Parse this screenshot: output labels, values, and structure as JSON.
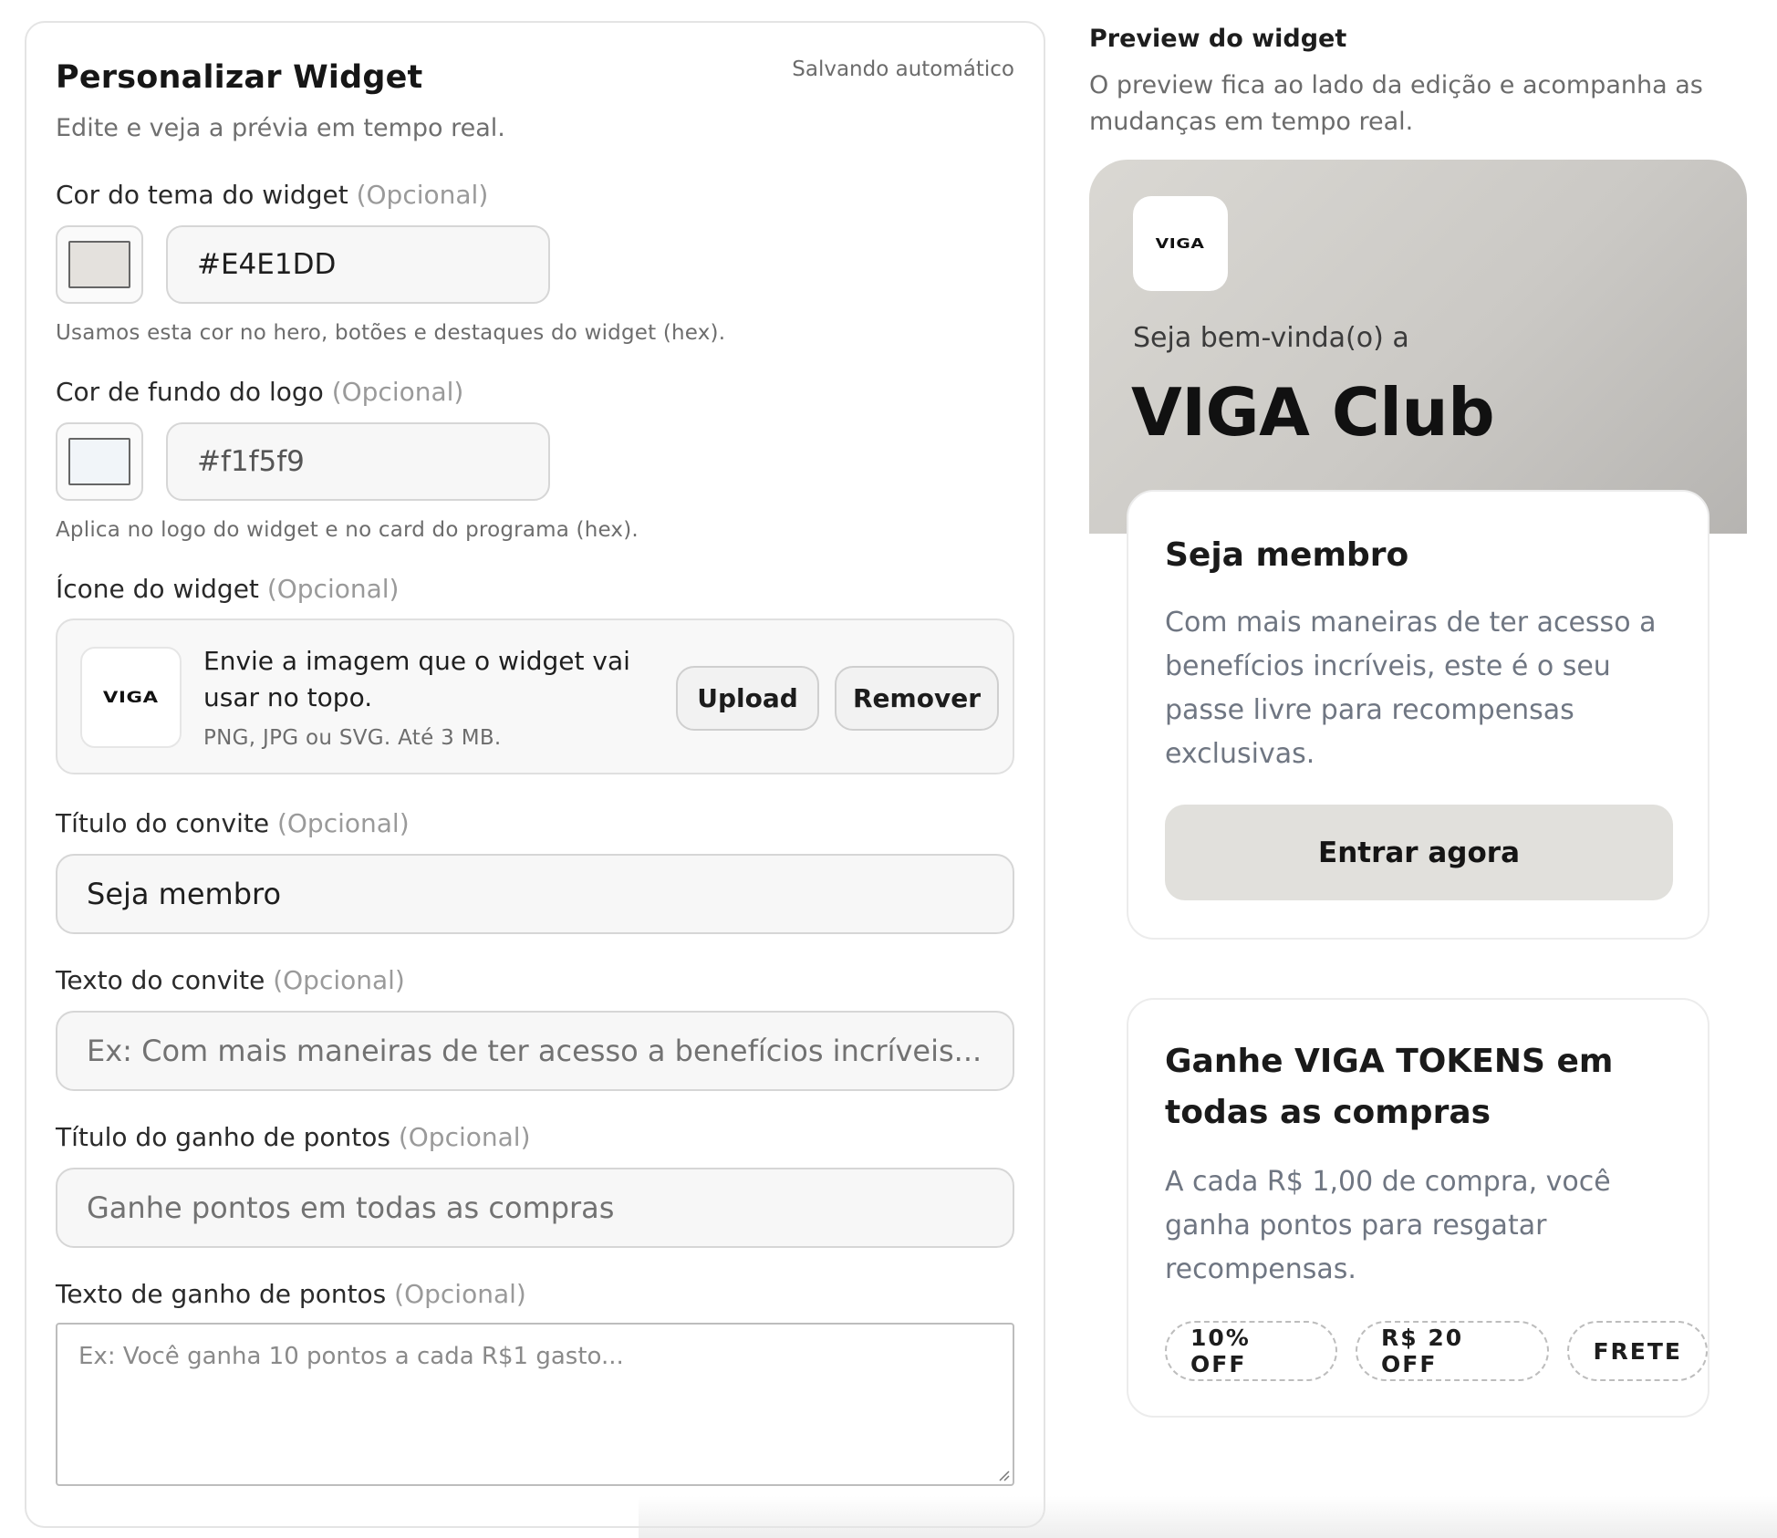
{
  "editor": {
    "title": "Personalizar Widget",
    "autosave": "Salvando automático",
    "subtitle": "Edite e veja a prévia em tempo real.",
    "optional_tag": "(Opcional)",
    "theme_color": {
      "label": "Cor do tema do widget",
      "value": "#E4E1DD",
      "swatch": "#E4E1DD",
      "hint": "Usamos esta cor no hero, botões e destaques do widget (hex)."
    },
    "logo_bg_color": {
      "label": "Cor de fundo do logo",
      "value": "#f1f5f9",
      "swatch": "#f1f5f9",
      "hint": "Aplica no logo do widget e no card do programa (hex)."
    },
    "widget_icon": {
      "label": "Ícone do widget",
      "logo_text": "VIGA",
      "description": "Envie a imagem que o widget vai usar no topo.",
      "formats": "PNG, JPG ou SVG. Até 3 MB.",
      "upload_label": "Upload",
      "remove_label": "Remover"
    },
    "invite_title": {
      "label": "Título do convite",
      "value": "Seja membro"
    },
    "invite_text": {
      "label": "Texto do convite",
      "placeholder": "Ex: Com mais maneiras de ter acesso a benefícios incríveis..."
    },
    "points_title": {
      "label": "Título do ganho de pontos",
      "placeholder": "Ganhe pontos em todas as compras"
    },
    "points_text": {
      "label": "Texto de ganho de pontos",
      "placeholder": "Ex: Você ganha 10 pontos a cada R$1 gasto..."
    }
  },
  "preview": {
    "title": "Preview do widget",
    "subtitle": "O preview fica ao lado da edição e acompanha as mudanças em tempo real.",
    "logo_text": "VIGA",
    "welcome": "Seja bem-vinda(o) a",
    "club_name": "VIGA Club",
    "invite_card": {
      "title": "Seja membro",
      "text": "Com mais maneiras de ter acesso a benefícios incríveis, este é o seu passe livre para recompensas exclusivas.",
      "cta": "Entrar agora"
    },
    "points_card": {
      "title": "Ganhe VIGA TOKENS em todas as compras",
      "text": "A cada R$ 1,00 de compra, você ganha pontos para resgatar recompensas.",
      "rewards": [
        "10% OFF",
        "R$ 20 OFF",
        "FRETE"
      ]
    }
  }
}
